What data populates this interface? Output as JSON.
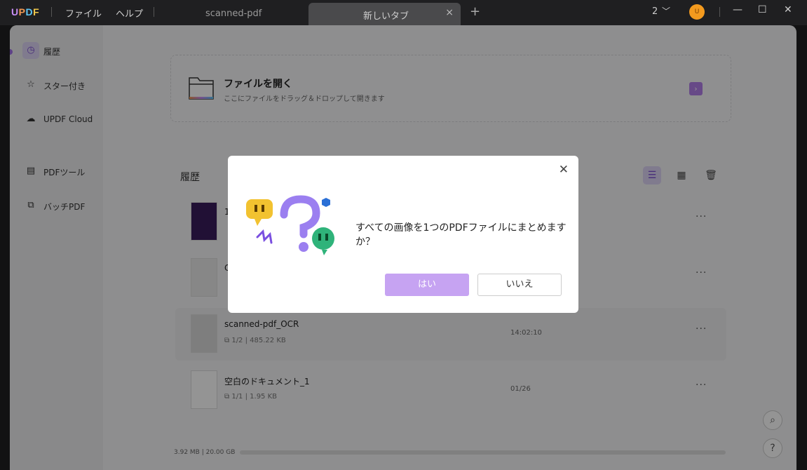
{
  "titlebar": {
    "logo": {
      "u": "U",
      "p": "P",
      "d": "D",
      "f": "F"
    },
    "menu": [
      "ファイル",
      "ヘルプ"
    ],
    "tabs": [
      {
        "label": "scanned-pdf"
      },
      {
        "label": "新しいタブ",
        "close": "×"
      }
    ],
    "new_tab": "+",
    "page_count": "2",
    "avatar": "U",
    "controls": {
      "minimize": "—",
      "maximize": "☐",
      "close": "✕"
    }
  },
  "sidebar": {
    "items": [
      {
        "label": "履歴",
        "icon": "clock-icon"
      },
      {
        "label": "スター付き",
        "icon": "star-icon"
      },
      {
        "label": "UPDF Cloud",
        "icon": "cloud-icon"
      },
      {
        "label": "PDFツール",
        "icon": "toolbox-icon"
      },
      {
        "label": "バッチPDF",
        "icon": "batch-icon"
      }
    ]
  },
  "open_file": {
    "title": "ファイルを開く",
    "subtitle": "ここにファイルをドラッグ＆ドロップして開きます",
    "arrow": "›"
  },
  "history": {
    "title": "履歴",
    "rows": [
      {
        "name": "1",
        "meta": "",
        "time": ""
      },
      {
        "name": "C",
        "meta": "",
        "time": ""
      },
      {
        "name": "scanned-pdf_OCR",
        "pages": "1/2",
        "size": "485.22 KB",
        "time": "14:02:10"
      },
      {
        "name": "空白のドキュメント_1",
        "pages": "1/1",
        "size": "1.95 KB",
        "time": "01/26"
      }
    ],
    "more": "···"
  },
  "storage": "3.92 MB | 20.00 GB",
  "dialog": {
    "message": "すべての画像を1つのPDFファイルにまとめますか？",
    "yes": "はい",
    "no": "いいえ",
    "close": "✕"
  },
  "colors": {
    "accent": "#b27ee9",
    "overlay": "rgba(0,0,0,0.42)"
  }
}
